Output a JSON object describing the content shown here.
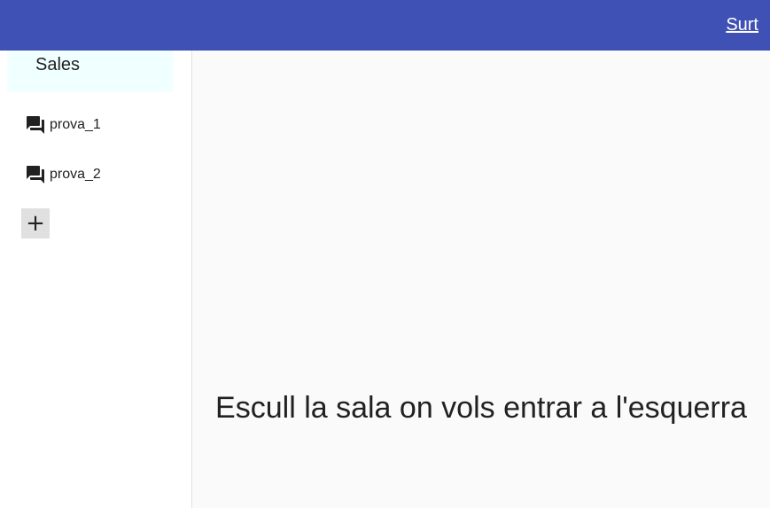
{
  "header": {
    "logout_label": "Surt",
    "background_color": "#3f51b5"
  },
  "sidebar": {
    "title": "Sales",
    "rooms": [
      {
        "label": "prova_1",
        "icon": "forum-icon"
      },
      {
        "label": "prova_2",
        "icon": "forum-icon"
      }
    ],
    "add_label": "+"
  },
  "main": {
    "prompt": "Escull la sala on vols entrar a l'esquerra"
  }
}
